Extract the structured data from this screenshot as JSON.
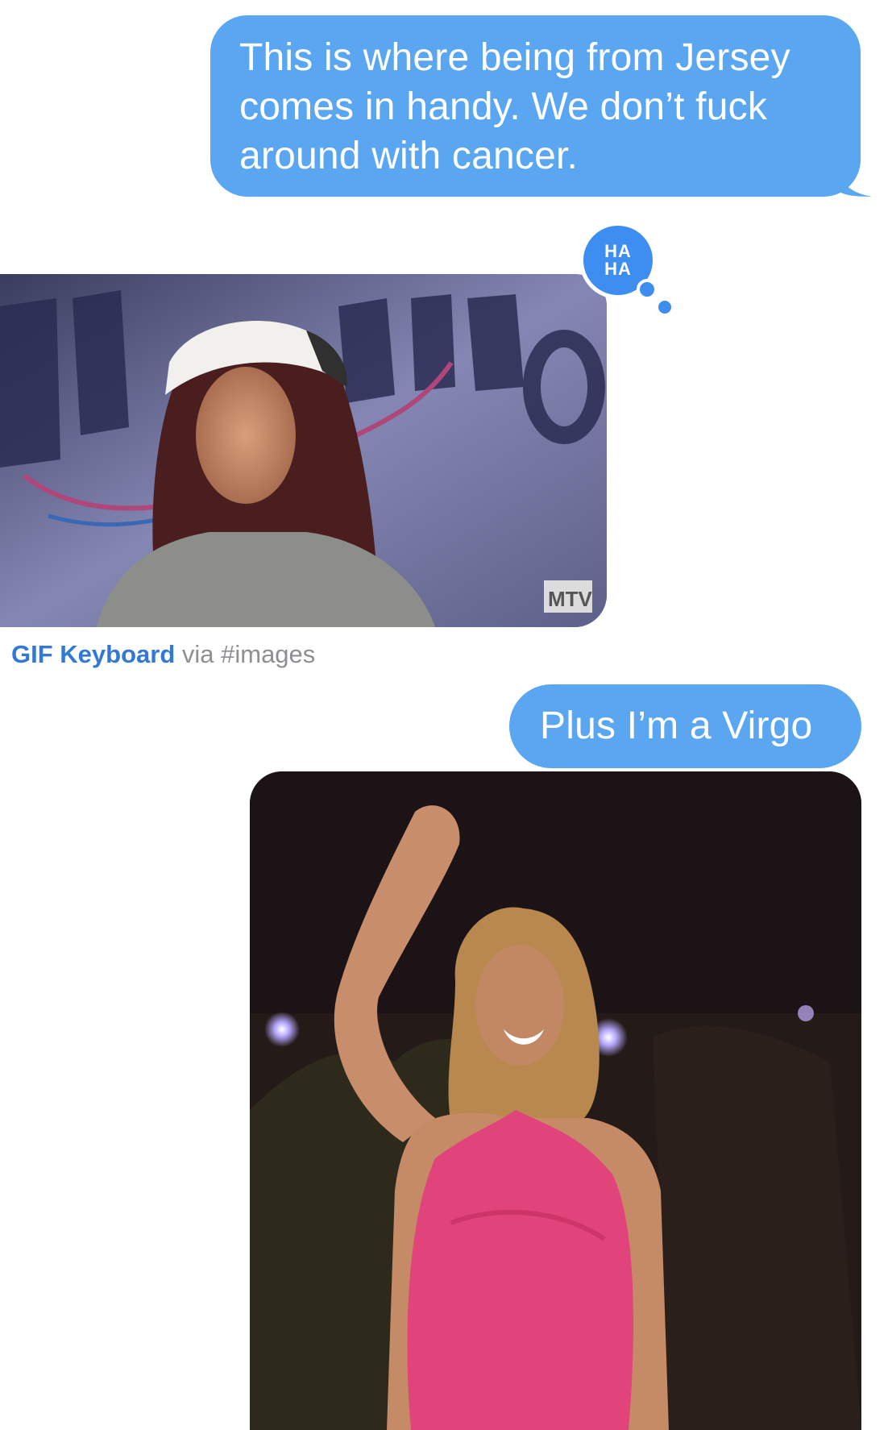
{
  "conversation": {
    "messages": [
      {
        "from": "me",
        "type": "text",
        "text": "This is where being from Jersey comes in handy. We don’t fuck around with cancer."
      },
      {
        "from": "them",
        "type": "gif",
        "tapback": "HA HA",
        "gif_badge": "MTV",
        "caption_app": "GIF Keyboard",
        "caption_via": " via #images"
      },
      {
        "from": "me",
        "type": "text",
        "text": "Plus I’m a Virgo"
      },
      {
        "from": "me",
        "type": "gif"
      }
    ]
  },
  "colors": {
    "outgoing_bubble": "#5ba6f0",
    "tapback": "#3d8ef0",
    "caption_app": "#3478d6",
    "caption_gray": "#8e8e93"
  },
  "icons": [
    "haha-tapback-icon",
    "mtv-logo-icon"
  ]
}
